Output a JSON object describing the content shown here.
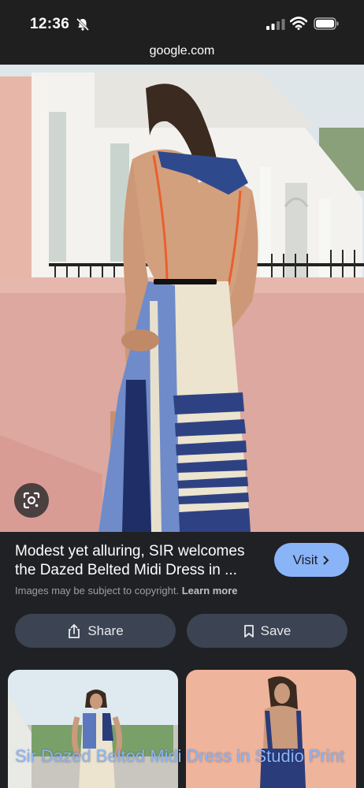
{
  "status_bar": {
    "time": "12:36"
  },
  "url_bar": {
    "domain": "google.com"
  },
  "result": {
    "title": "Modest yet alluring, SIR welcomes the Dazed Belted Midi Dress in ...",
    "copyright_text": "Images may be subject to copyright.",
    "learn_more": "Learn more",
    "visit_label": "Visit"
  },
  "actions": {
    "share_label": "Share",
    "save_label": "Save"
  },
  "related": {
    "title": "Sir Dazed Belted Midi Dress in Studio Print"
  }
}
